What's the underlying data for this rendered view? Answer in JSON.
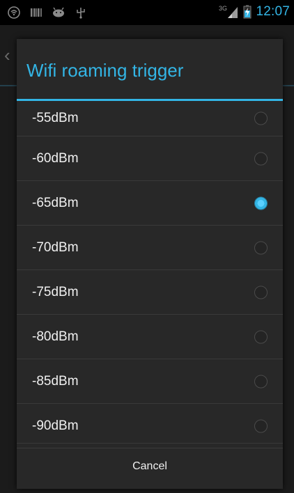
{
  "status_bar": {
    "time": "12:07",
    "network_type": "3G",
    "icons": [
      "wifi-portable-icon",
      "barcode-icon",
      "android-icon",
      "usb-icon",
      "signal-icon",
      "battery-charging-icon"
    ]
  },
  "dialog": {
    "title": "Wifi roaming trigger",
    "options": [
      {
        "label": "-55dBm",
        "selected": false
      },
      {
        "label": "-60dBm",
        "selected": false
      },
      {
        "label": "-65dBm",
        "selected": true
      },
      {
        "label": "-70dBm",
        "selected": false
      },
      {
        "label": "-75dBm",
        "selected": false
      },
      {
        "label": "-80dBm",
        "selected": false
      },
      {
        "label": "-85dBm",
        "selected": false
      },
      {
        "label": "-90dBm",
        "selected": false
      }
    ],
    "cancel_label": "Cancel"
  },
  "colors": {
    "accent": "#33b5e5",
    "dialog_bg": "#282828",
    "text": "#f0f0f0"
  }
}
